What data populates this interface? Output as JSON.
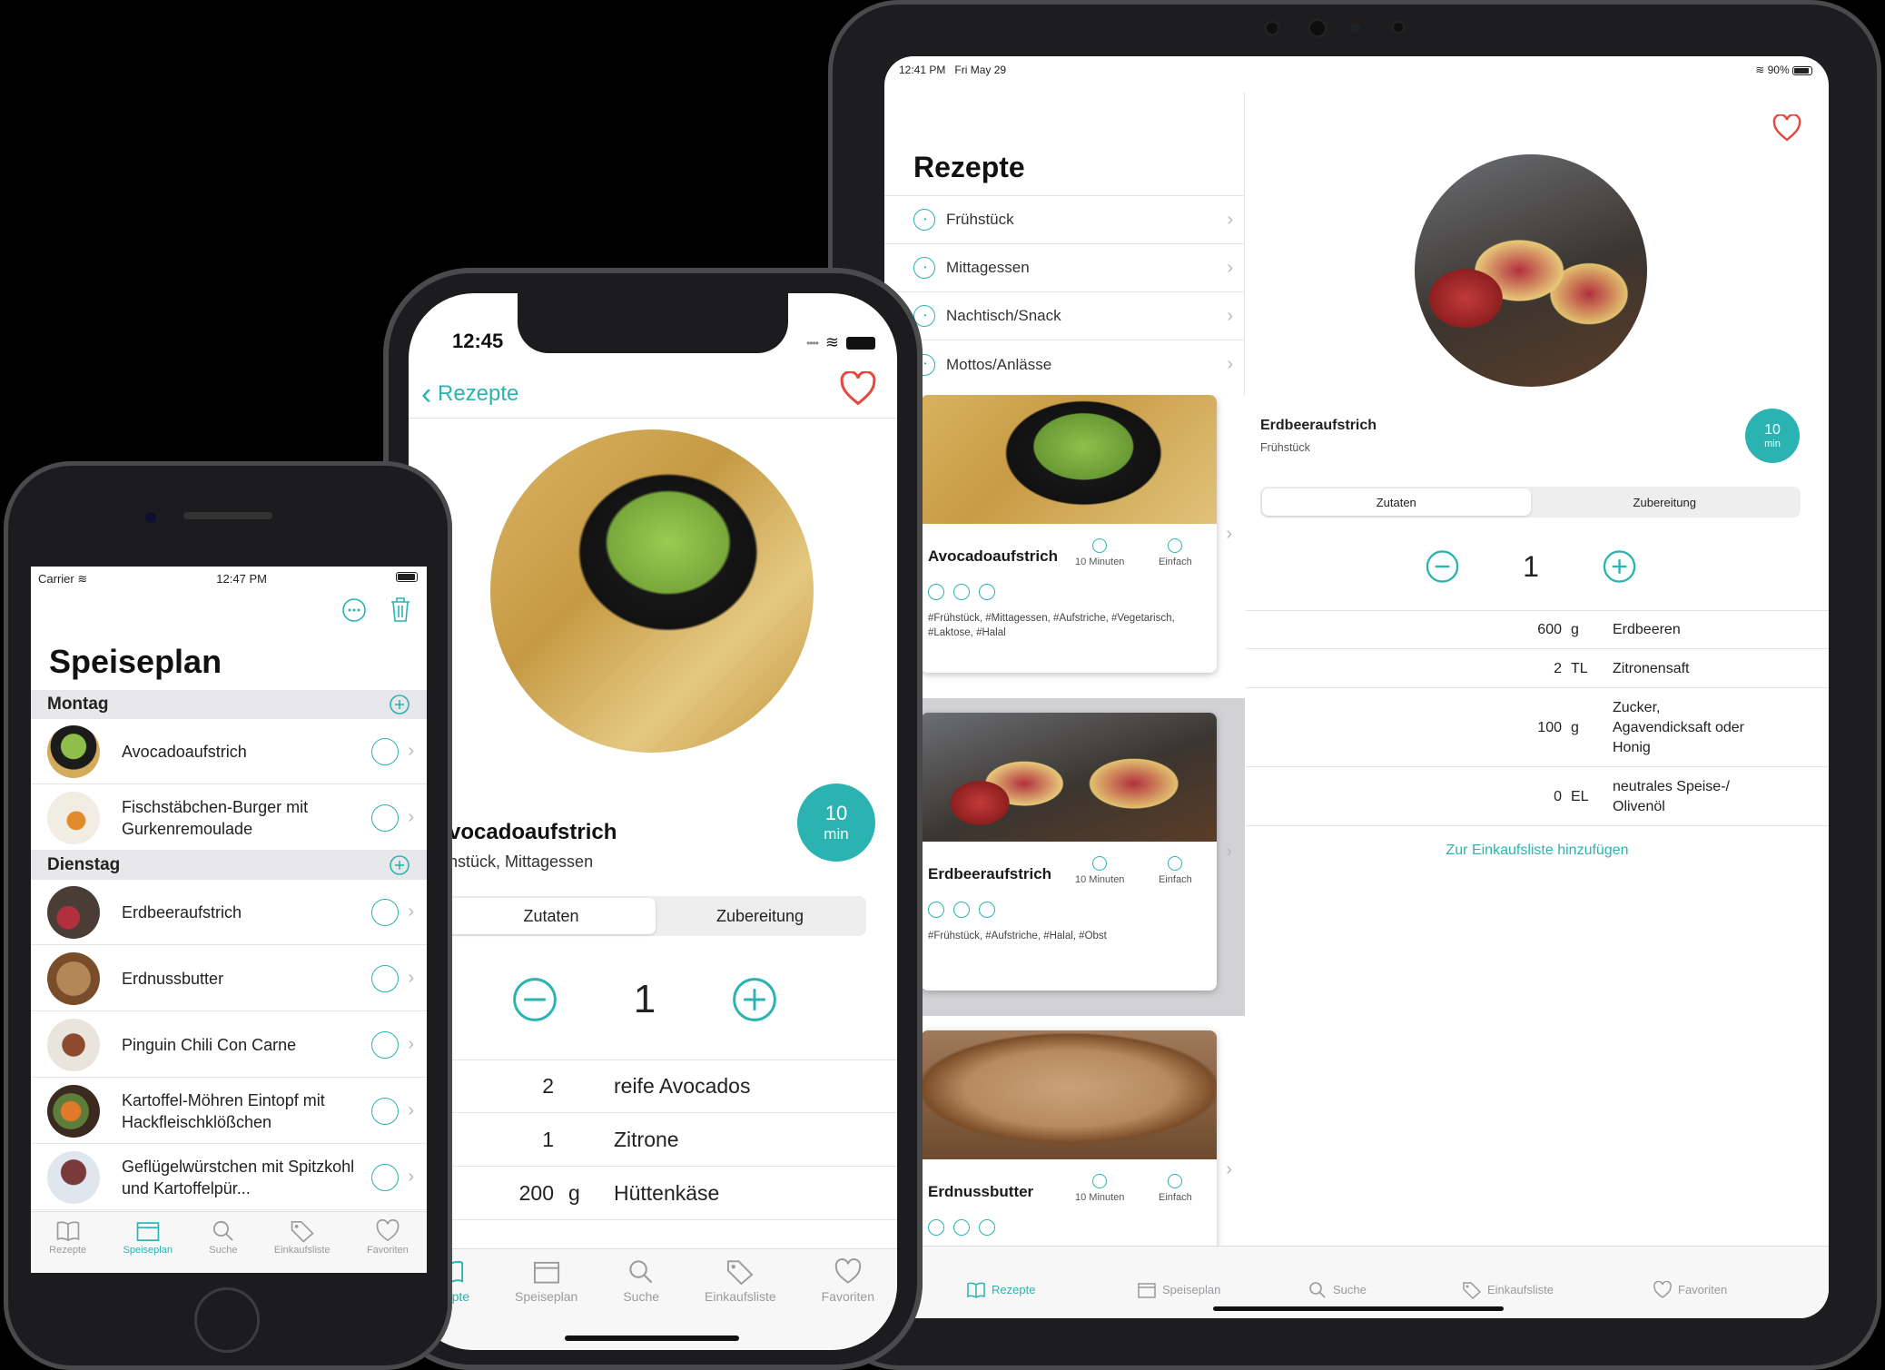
{
  "ipad": {
    "status": {
      "time": "12:41 PM",
      "date": "Fri May 29",
      "battery": "90%"
    },
    "title": "Rezepte",
    "categories": [
      {
        "label": "Frühstück"
      },
      {
        "label": "Mittagessen"
      },
      {
        "label": "Nachtisch/Snack"
      },
      {
        "label": "Mottos/Anlässe"
      }
    ],
    "cards": [
      {
        "title": "Avocadoaufstrich",
        "time": "10 Minuten",
        "difficulty": "Einfach",
        "tags": "#Frühstück, #Mittagessen, #Aufstriche, #Vegetarisch, #Laktose, #Halal"
      },
      {
        "title": "Erdbeeraufstrich",
        "time": "10 Minuten",
        "difficulty": "Einfach",
        "tags": "#Frühstück, #Aufstriche, #Halal, #Obst"
      },
      {
        "title": "Erdnussbutter",
        "time": "10 Minuten",
        "difficulty": "Einfach",
        "tags": ""
      }
    ],
    "detail": {
      "title": "Erdbeeraufstrich",
      "subtitle": "Frühstück",
      "time_value": "10",
      "time_unit": "min",
      "seg_ingredients": "Zutaten",
      "seg_preparation": "Zubereitung",
      "servings": "1",
      "ingredients": [
        {
          "amount": "600",
          "unit": "g",
          "name": "Erdbeeren"
        },
        {
          "amount": "2",
          "unit": "TL",
          "name": "Zitronensaft"
        },
        {
          "amount": "100",
          "unit": "g",
          "name": "Zucker, Agavendicksaft oder Honig"
        },
        {
          "amount": "0",
          "unit": "EL",
          "name": "neutrales Speise-/ Olivenöl"
        }
      ],
      "add_to_list": "Zur Einkaufsliste hinzufügen"
    },
    "tabs": [
      "Rezepte",
      "Speiseplan",
      "Suche",
      "Einkaufsliste",
      "Favoriten"
    ]
  },
  "iphonex": {
    "time": "12:45",
    "back": "Rezepte",
    "title": "vocadoaufstrich",
    "subtitle": "hstück, Mittagessen",
    "time_value": "10",
    "time_unit": "min",
    "seg_ingredients": "Zutaten",
    "seg_preparation": "Zubereitung",
    "servings": "1",
    "ingredients": [
      {
        "amount": "2",
        "unit": "",
        "name": "reife Avocados"
      },
      {
        "amount": "1",
        "unit": "",
        "name": "Zitrone"
      },
      {
        "amount": "200",
        "unit": "g",
        "name": "Hüttenkäse"
      }
    ],
    "tabs": [
      "ezepte",
      "Speiseplan",
      "Suche",
      "Einkaufsliste",
      "Favoriten"
    ]
  },
  "iphone8": {
    "status": {
      "carrier": "Carrier",
      "time": "12:47 PM"
    },
    "title": "Speiseplan",
    "days": [
      {
        "name": "Montag"
      },
      {
        "name": "Dienstag"
      }
    ],
    "meals": [
      {
        "name": "Avocadoaufstrich"
      },
      {
        "name": "Fischstäbchen-Burger mit Gurkenremoulade"
      },
      {
        "name": "Erdbeeraufstrich"
      },
      {
        "name": "Erdnussbutter"
      },
      {
        "name": "Pinguin Chili Con Carne"
      },
      {
        "name": "Kartoffel-Möhren Eintopf mit Hackfleischklößchen"
      },
      {
        "name": "Geflügelwürstchen mit Spitzkohl und Kartoffelpür..."
      }
    ],
    "tabs": [
      "Rezepte",
      "Speiseplan",
      "Suche",
      "Einkaufsliste",
      "Favoriten"
    ]
  },
  "colors": {
    "accent": "#2ab3b1",
    "heart": "#e8473f"
  }
}
